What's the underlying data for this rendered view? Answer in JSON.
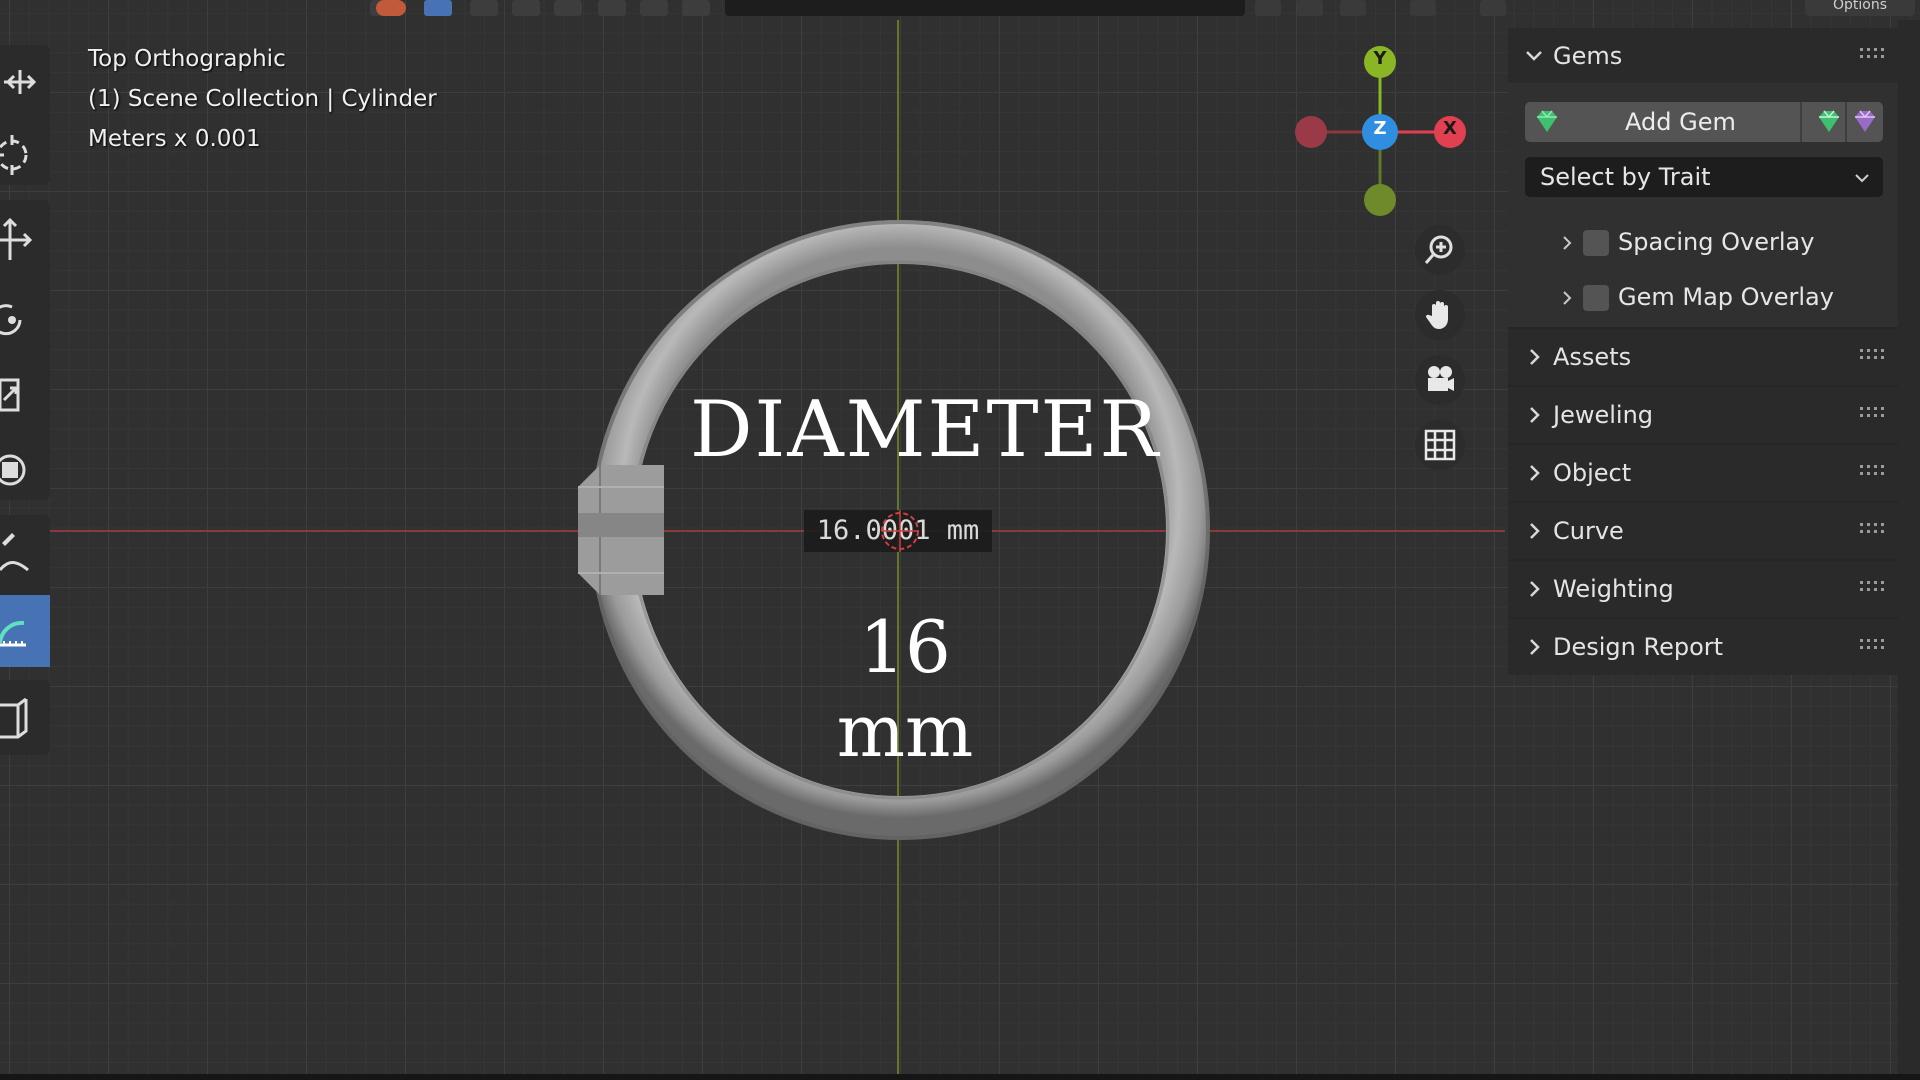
{
  "viewport": {
    "view_name": "Top Orthographic",
    "collection": "(1) Scene Collection | Cylinder",
    "units": "Meters x 0.001"
  },
  "header": {
    "options_label": "Options"
  },
  "overlay": {
    "title": "DIAMETER",
    "measurement_readout": "16.0001 mm",
    "value": "16 mm"
  },
  "gizmo": {
    "x_label": "X",
    "y_label": "Y",
    "z_label": "Z",
    "colors": {
      "x": "#e14050",
      "y": "#8ab625",
      "z": "#2f8ee0"
    }
  },
  "panel": {
    "gems": {
      "header": "Gems",
      "add_gem_label": "Add Gem",
      "select_by_trait": "Select by Trait",
      "spacing_overlay": "Spacing Overlay",
      "gem_map_overlay": "Gem Map Overlay"
    },
    "sections": [
      "Assets",
      "Jeweling",
      "Object",
      "Curve",
      "Weighting",
      "Design Report"
    ]
  },
  "toolbar": {
    "tools": [
      "move-icon",
      "cursor-icon",
      "transform-icon",
      "rotate-icon",
      "scale-icon",
      "transform-all-icon",
      "annotate-icon",
      "measure-icon",
      "add-cube-icon"
    ],
    "active_tool": "measure-icon"
  },
  "navigation": [
    "zoom-icon",
    "pan-hand-icon",
    "camera-icon",
    "grid-icon"
  ],
  "colors": {
    "accent": "#4772b3",
    "gem_green": "#3fc070",
    "gem_purple": "#9a6ac8"
  }
}
